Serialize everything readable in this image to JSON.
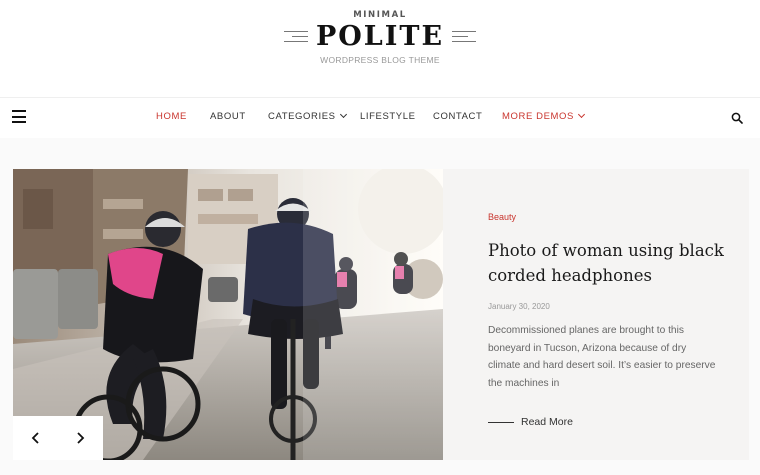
{
  "brand": {
    "top": "MINIMAL",
    "name": "POLITE",
    "tagline": "WORDPRESS BLOG THEME"
  },
  "nav": {
    "items": [
      {
        "label": "HOME",
        "active": true,
        "dropdown": false
      },
      {
        "label": "ABOUT",
        "active": false,
        "dropdown": false
      },
      {
        "label": "CATEGORIES",
        "active": false,
        "dropdown": true
      },
      {
        "label": "LIFESTYLE",
        "active": false,
        "dropdown": false
      },
      {
        "label": "CONTACT",
        "active": false,
        "dropdown": false
      },
      {
        "label": "MORE DEMOS",
        "active": true,
        "dropdown": true
      }
    ],
    "menu_icon": "hamburger-icon",
    "search_icon": "search-icon"
  },
  "slide": {
    "category": "Beauty",
    "title": "Photo of woman using black corded headphones",
    "date": "January 30, 2020",
    "excerpt": "Decommissioned planes are brought to this boneyard in Tucson, Arizona because of dry climate and hard desert soil. It’s easier to preserve the machines in",
    "read_more": "Read More",
    "image_icon": "cyclists-photo",
    "prev_icon": "chevron-left-icon",
    "next_icon": "chevron-right-icon"
  },
  "colors": {
    "accent": "#c9352e",
    "text": "#222222",
    "muted": "#999999",
    "card_bg": "#f5f4f3"
  }
}
